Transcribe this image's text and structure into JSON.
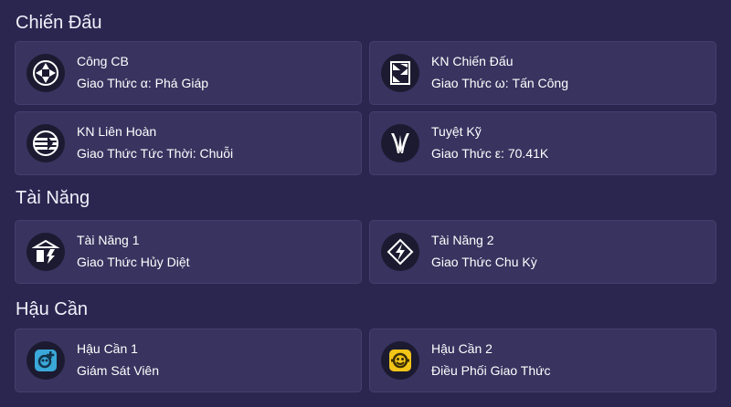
{
  "sections": [
    {
      "title": "Chiến Đấu",
      "cards": [
        {
          "name": "Công CB",
          "value": "Giao Thức α: Phá Giáp",
          "icon": "basic-attack-icon"
        },
        {
          "name": "KN Chiến Đấu",
          "value": "Giao Thức ω: Tấn Công",
          "icon": "battle-skill-icon"
        },
        {
          "name": "KN Liên Hoàn",
          "value": "Giao Thức Tức Thời: Chuỗi",
          "icon": "combo-skill-icon"
        },
        {
          "name": "Tuyệt Kỹ",
          "value": "Giao Thức ε: 70.41K",
          "icon": "ultimate-icon"
        }
      ]
    },
    {
      "title": "Tài Năng",
      "cards": [
        {
          "name": "Tài Năng 1",
          "value": "Giao Thức Hủy Diệt",
          "icon": "talent-1-icon"
        },
        {
          "name": "Tài Năng 2",
          "value": "Giao Thức Chu Kỳ",
          "icon": "talent-2-icon"
        }
      ]
    },
    {
      "title": "Hậu Cần",
      "cards": [
        {
          "name": "Hậu Cần 1",
          "value": "Giám Sát Viên",
          "icon": "logistics-1-icon"
        },
        {
          "name": "Hậu Cần 2",
          "value": "Điều Phối Giao Thức",
          "icon": "logistics-2-icon"
        }
      ]
    }
  ],
  "colors": {
    "background": "#2b2650",
    "card": "#38335f",
    "card_border": "#443f6d",
    "icon_bg": "#1c1a30",
    "logistics_1_accent": "#3aa8d8",
    "logistics_2_accent": "#f2c417"
  }
}
